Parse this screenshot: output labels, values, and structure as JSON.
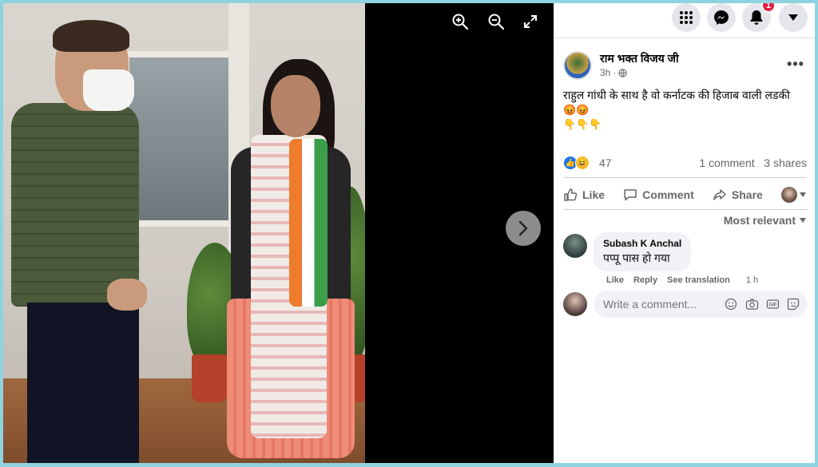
{
  "viewer": {
    "zoom_in": "zoom-in",
    "zoom_out": "zoom-out",
    "fullscreen": "fullscreen",
    "next": "next-photo"
  },
  "topnav": {
    "notifications_badge": "1"
  },
  "post": {
    "author": "राम भक्त विजय जी",
    "time": "3h",
    "privacy_icon": "globe-icon",
    "text": "राहुल गांधी के साथ है वो कर्नाटक की हिजाब वाली लडकी",
    "emoji_line1": "😡😡",
    "emoji_line2": "👇👇👇",
    "reaction_count": "47",
    "comments_count": "1 comment",
    "shares_count": "3 shares"
  },
  "actions": {
    "like": "Like",
    "comment": "Comment",
    "share": "Share"
  },
  "comments": {
    "sort_label": "Most relevant",
    "items": [
      {
        "author": "Subash K Anchal",
        "text": "पप्पू पास हो गया",
        "like": "Like",
        "reply": "Reply",
        "translate": "See translation",
        "time": "1 h"
      }
    ],
    "write_placeholder": "Write a comment..."
  },
  "colors": {
    "accent": "#1877f2",
    "badge": "#e41e3f",
    "text_secondary": "#65676b"
  }
}
